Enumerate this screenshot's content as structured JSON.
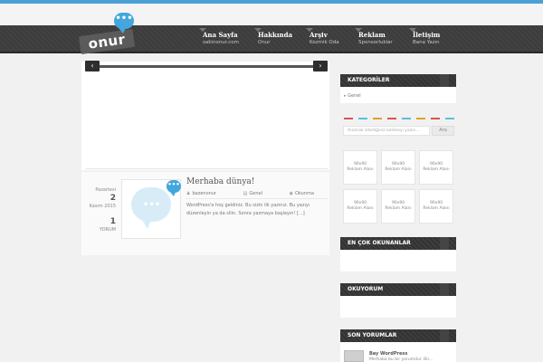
{
  "brand": {
    "logo_text": "onur",
    "logo_bubble": "•••"
  },
  "menu": [
    {
      "title": "Ana Sayfa",
      "sub": "sakinonur.com"
    },
    {
      "title": "Hakkında",
      "sub": "Onur"
    },
    {
      "title": "Arşiv",
      "sub": "Kozmik Oda"
    },
    {
      "title": "Reklam",
      "sub": "Sponsorluklar"
    },
    {
      "title": "İletişim",
      "sub": "Bana Yazın"
    }
  ],
  "slider": {
    "prev": "‹",
    "next": "›"
  },
  "post": {
    "day_name": "Pazartesi",
    "day": "2",
    "month_year": "Kasım 2015",
    "comment_count": "1",
    "comment_label": "YORUM",
    "title": "Merhaba dünya!",
    "author": "bazenonur",
    "category": "Genel",
    "read_label": "Okunma",
    "excerpt": "WordPress'e hoş geldiniz. Bu sizin ilk yazınız. Bu yazıyı düzenleyin ya da silin. Sonra yazmaya başlayın! [...]",
    "thumb_badge": "•••",
    "thumb_dots": "•••"
  },
  "sidebar": {
    "categories_title": "KATEGORİLER",
    "category_items": [
      "Genel"
    ],
    "search_placeholder": "Aramak istediğiniz kelimeyi yazın...",
    "search_button": "Ara",
    "ads": [
      {
        "size": "90x90",
        "label": "Reklam Alanı"
      },
      {
        "size": "90x90",
        "label": "Reklam Alanı"
      },
      {
        "size": "90x90",
        "label": "Reklam Alanı"
      },
      {
        "size": "90x90",
        "label": "Reklam Alanı"
      },
      {
        "size": "90x90",
        "label": "Reklam Alanı"
      },
      {
        "size": "90x90",
        "label": "Reklam Alanı"
      }
    ],
    "most_read_title": "EN ÇOK OKUNANLAR",
    "reading_title": "OKUYORUM",
    "recent_comments_title": "SON YORUMLAR",
    "recent_comment": {
      "name": "Bay WordPress",
      "text": "Merhaba bu bir yorumdur. Bir..."
    }
  },
  "colors": {
    "accent": "#43a6dc",
    "nav": "#3c3c3c"
  }
}
